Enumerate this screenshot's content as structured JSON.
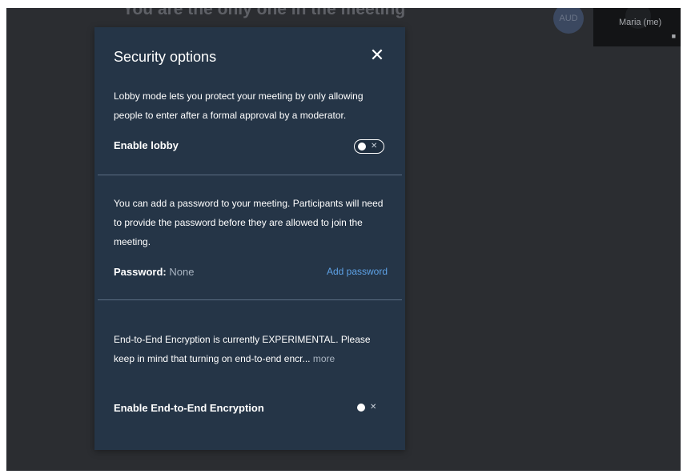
{
  "background": {
    "meeting_message": "You are the only one in the meeting",
    "participant_avatar_initials": "AUD",
    "self_tile_name": "Maria (me)"
  },
  "dialog": {
    "title": "Security options",
    "lobby": {
      "description": "Lobby mode lets you protect your meeting by only allowing people to enter after a formal approval by a moderator.",
      "toggle_label": "Enable lobby",
      "enabled": false
    },
    "password": {
      "description": "You can add a password to your meeting. Participants will need to provide the password before they are allowed to join the meeting.",
      "label": "Password:",
      "value": "None",
      "add_link": "Add password"
    },
    "e2ee": {
      "description": "End-to-End Encryption is currently EXPERIMENTAL. Please keep in mind that turning on end-to-end encr...",
      "more_link": "more",
      "toggle_label": "Enable End-to-End Encryption",
      "enabled": false
    }
  },
  "colors": {
    "stage_background": "#2b2d31",
    "dialog_background": "#253547",
    "link": "#5ea2e6"
  }
}
